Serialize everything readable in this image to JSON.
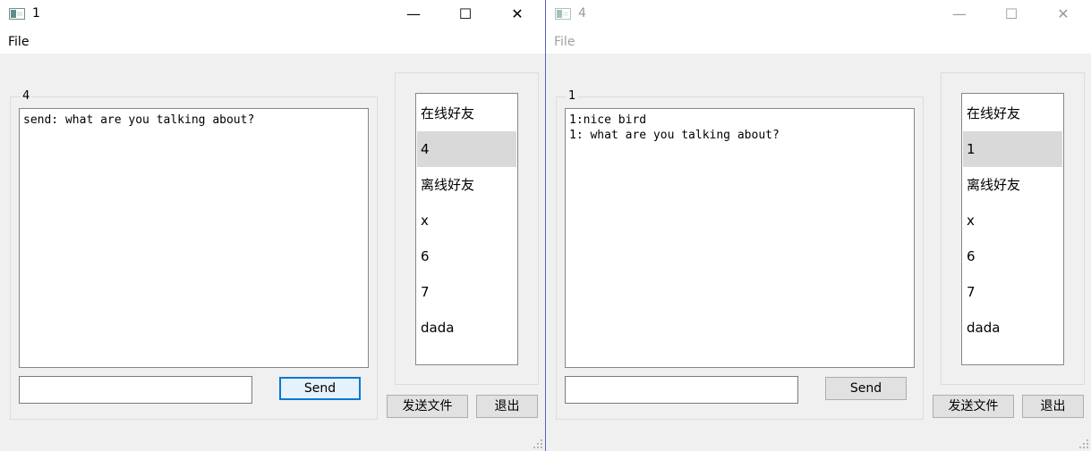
{
  "windows": [
    {
      "title": "1",
      "menu_file": "File",
      "chat_group_title": "4",
      "chat_lines": "send: what are you talking about?",
      "input_value": "",
      "send_label": "Send",
      "send_file_label": "发送文件",
      "exit_label": "退出",
      "friends": [
        "在线好友",
        "4",
        "离线好友",
        "x",
        "6",
        "7",
        "dada"
      ],
      "selected_friend": "4"
    },
    {
      "title": "4",
      "menu_file": "File",
      "chat_group_title": "1",
      "chat_lines": "1:nice bird\n1: what are you talking about?",
      "input_value": "",
      "send_label": "Send",
      "send_file_label": "发送文件",
      "exit_label": "退出",
      "friends": [
        "在线好友",
        "1",
        "离线好友",
        "x",
        "6",
        "7",
        "dada"
      ],
      "selected_friend": "1"
    }
  ],
  "titlebar_icons": {
    "minimize": "minimize-icon",
    "maximize": "maximize-icon",
    "close": "close-icon"
  },
  "colors": {
    "focus_border": "#0078d7",
    "selected_row": "#d9d9d9",
    "window_bg": "#f0f0f0"
  }
}
